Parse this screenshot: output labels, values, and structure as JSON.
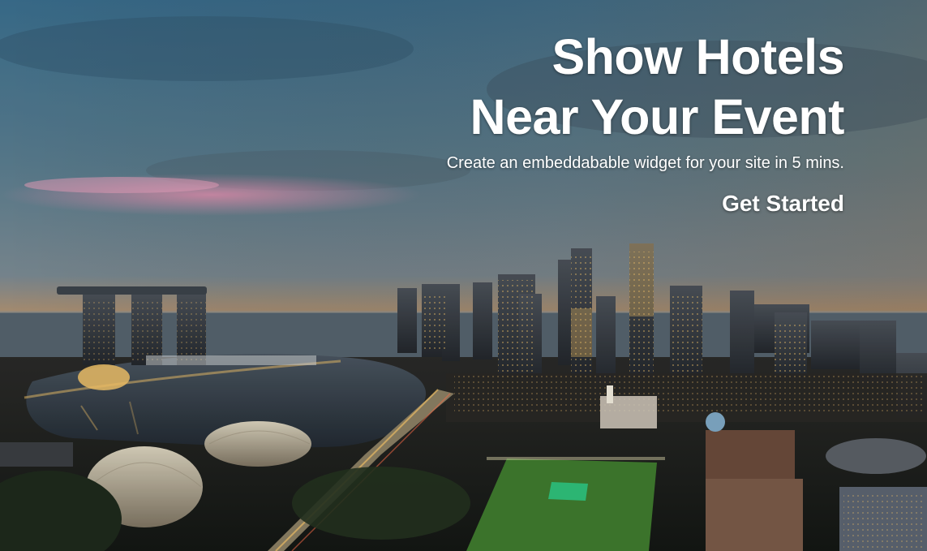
{
  "hero": {
    "title_line1": "Show Hotels",
    "title_line2": "Near Your Event",
    "subtitle": "Create an embeddabable widget for your site in 5 mins.",
    "cta_label": "Get Started"
  },
  "colors": {
    "sky_top": "#3b6f8f",
    "sky_mid": "#5c7f91",
    "sky_horizon": "#c9996a",
    "cloud_pink": "#d98aa8",
    "water": "#2b3440",
    "city_dark": "#1c2127",
    "lights": "#f6c56a",
    "field_green": "#3f7a2e",
    "text": "#ffffff"
  }
}
